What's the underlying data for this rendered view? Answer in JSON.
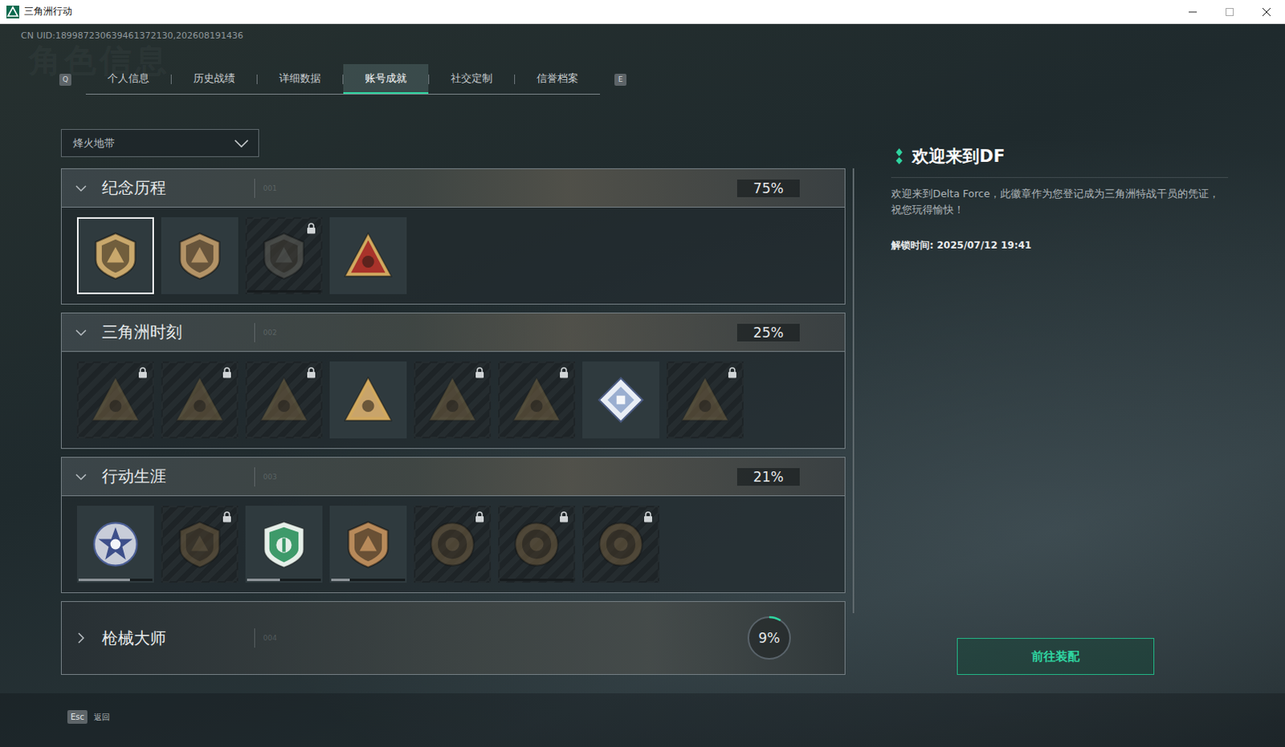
{
  "window": {
    "title": "三角洲行动"
  },
  "uid": "CN UID:189987230639461372130,202608191436",
  "watermark": "角色信息",
  "tabs": {
    "prev_key": "Q",
    "next_key": "E",
    "items": [
      {
        "label": "个人信息",
        "selected": false
      },
      {
        "label": "历史战绩",
        "selected": false
      },
      {
        "label": "详细数据",
        "selected": false
      },
      {
        "label": "账号成就",
        "selected": true
      },
      {
        "label": "社交定制",
        "selected": false
      },
      {
        "label": "信誉档案",
        "selected": false
      }
    ]
  },
  "mode_select": {
    "value": "烽火地带"
  },
  "sections": [
    {
      "title": "纪念历程",
      "code": "001",
      "percent": "75%",
      "expanded": true,
      "badges": [
        {
          "kind": "shield",
          "color": "#c9a86c",
          "locked": false,
          "selected": true
        },
        {
          "kind": "shield",
          "color": "#b39366",
          "locked": false,
          "selected": false
        },
        {
          "kind": "shield",
          "color": "#5e5e58",
          "locked": true,
          "selected": false,
          "level": 0
        },
        {
          "kind": "triangle",
          "color": "#a8322a",
          "locked": false,
          "selected": false
        }
      ]
    },
    {
      "title": "三角洲时刻",
      "code": "002",
      "percent": "25%",
      "expanded": true,
      "badges": [
        {
          "kind": "triangle",
          "color": "#6b5a3e",
          "locked": true,
          "selected": false
        },
        {
          "kind": "triangle",
          "color": "#6b5a3e",
          "locked": true,
          "selected": false
        },
        {
          "kind": "triangle",
          "color": "#6b5a3e",
          "locked": true,
          "selected": false
        },
        {
          "kind": "triangle",
          "color": "#c9a46a",
          "locked": false,
          "selected": false
        },
        {
          "kind": "triangle",
          "color": "#6b5a3e",
          "locked": true,
          "selected": false
        },
        {
          "kind": "triangle",
          "color": "#6b5a3e",
          "locked": true,
          "selected": false
        },
        {
          "kind": "diamond",
          "color": "#9aaed0",
          "locked": false,
          "selected": false
        },
        {
          "kind": "triangle",
          "color": "#6b5a3e",
          "locked": true,
          "selected": false
        }
      ]
    },
    {
      "title": "行动生涯",
      "code": "003",
      "percent": "21%",
      "expanded": true,
      "badges": [
        {
          "kind": "star",
          "color": "#c8cdd9",
          "locked": false,
          "selected": false,
          "level": 0.7
        },
        {
          "kind": "shield",
          "color": "#6b5a3e",
          "locked": true,
          "selected": false
        },
        {
          "kind": "crest",
          "color": "#3e9a6a",
          "locked": false,
          "selected": false,
          "level": 0.45
        },
        {
          "kind": "shield",
          "color": "#b88a5a",
          "locked": false,
          "selected": false,
          "level": 0.25
        },
        {
          "kind": "round",
          "color": "#6b5a3e",
          "locked": true,
          "selected": false
        },
        {
          "kind": "round",
          "color": "#6b5a3e",
          "locked": true,
          "selected": false,
          "level": 0
        },
        {
          "kind": "round",
          "color": "#6b5a3e",
          "locked": true,
          "selected": false
        }
      ]
    },
    {
      "title": "枪械大师",
      "code": "004",
      "percent": "9%",
      "expanded": false,
      "level": 0.09,
      "badges": []
    }
  ],
  "detail": {
    "title": "欢迎来到DF",
    "description": "欢迎来到Delta Force，此徽章作为您登记成为三角洲特战干员的凭证，祝您玩得愉快！",
    "unlock_time": "解锁时间: 2025/07/12 19:41",
    "button": "前往装配"
  },
  "footer": {
    "key": "Esc",
    "label": "返回"
  }
}
